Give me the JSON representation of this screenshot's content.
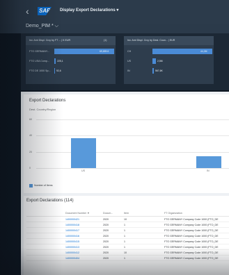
{
  "shell": {
    "logo_text": "SAP",
    "app_title": "Display Export Declarations",
    "app_title_chevron": "▾",
    "back_icon": "‹"
  },
  "header": {
    "variant": "Demo_PIM *",
    "variant_chevron": "⌵"
  },
  "kpi_panels": [
    {
      "header": "Inv. Amt Displ. Crcy by FT ... | K EUR",
      "badge": "(1)",
      "rows": [
        {
          "label": "FTO GERMANY...",
          "value_text": "69,659.6",
          "fraction": 1.0
        },
        {
          "label": "FTO USA Comp...",
          "value_text": "225,1",
          "fraction": 0.02
        },
        {
          "label": "FTO DE 1000 Sp...",
          "value_text": "92,6",
          "fraction": 0.01
        }
      ]
    },
    {
      "header": "Inv. Amt Displ. Crcy by Dest. Coun... | EUR",
      "badge": "",
      "rows": [
        {
          "label": "CH",
          "value_text": "44,2M",
          "fraction": 1.0
        },
        {
          "label": "US",
          "value_text": "2,5M",
          "fraction": 0.06
        },
        {
          "label": "IN",
          "value_text": "567,6K",
          "fraction": 0.02
        }
      ]
    }
  ],
  "chart_card": {
    "title": "Export Declarations",
    "subtitle": "Dest. Country/Region",
    "legend": "Number of Items"
  },
  "chart_data": {
    "type": "bar",
    "title": "Export Declarations",
    "xlabel": "Dest. Country/Region",
    "ylabel": "",
    "categories": [
      "US",
      "IN"
    ],
    "series": [
      {
        "name": "Number of Items",
        "values": [
          37,
          15
        ]
      }
    ],
    "ylim": [
      0,
      60
    ],
    "yticks": [
      0,
      20,
      40,
      60
    ],
    "grid": true,
    "legend": "bottom-left"
  },
  "table": {
    "title": "Export Declarations (114)",
    "columns": [
      "Document Number",
      "Docum...",
      "Item",
      "FT Organization"
    ],
    "sort_icon": "▼",
    "rows": [
      [
        "1400000421",
        "2020",
        "10",
        "FTO GERMANY Company Code 1000 (FTO_DE"
      ],
      [
        "1400000418",
        "2020",
        "1",
        "FTO GERMANY Company Code 1000 (FTO_DE"
      ],
      [
        "1400000417",
        "2020",
        "1",
        "FTO GERMANY Company Code 1000 (FTO_DE"
      ],
      [
        "1400000416",
        "2020",
        "1",
        "FTO GERMANY Company Code 1000 (FTO_DE"
      ],
      [
        "1400000415",
        "2020",
        "1",
        "FTO GERMANY Company Code 1000 (FTO_DE"
      ],
      [
        "1400000413",
        "2020",
        "1",
        "FTO GERMANY Company Code 1000 (FTO_DE"
      ],
      [
        "1400000412",
        "2020",
        "10",
        "FTO GERMANY Company Code 1000 (FTO_DE"
      ],
      [
        "1400000404",
        "2020",
        "1",
        "FTO GERMANY Company Code 1000 (FTO_DE"
      ]
    ]
  },
  "colors": {
    "bar": "#5899da",
    "kpi_bar": "#4a8bd6",
    "link": "#0a6ed1"
  }
}
